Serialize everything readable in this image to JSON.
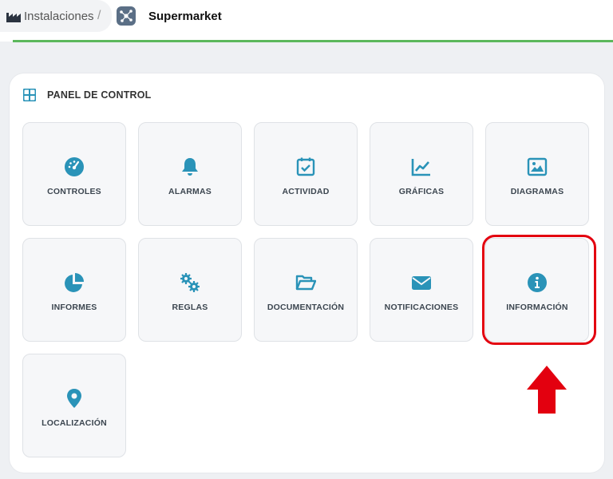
{
  "breadcrumb": {
    "home_label": "Instalaciones",
    "separator": "/",
    "site_name": "Supermarket"
  },
  "panel": {
    "title": "PANEL DE CONTROL"
  },
  "tiles": [
    {
      "label": "CONTROLES",
      "icon": "gauge-icon"
    },
    {
      "label": "ALARMAS",
      "icon": "bell-icon"
    },
    {
      "label": "ACTIVIDAD",
      "icon": "calendar-check-icon"
    },
    {
      "label": "GRÁFICAS",
      "icon": "line-chart-icon"
    },
    {
      "label": "DIAGRAMAS",
      "icon": "image-icon"
    },
    {
      "label": "INFORMES",
      "icon": "pie-chart-icon"
    },
    {
      "label": "REGLAS",
      "icon": "gears-icon"
    },
    {
      "label": "DOCUMENTACIÓN",
      "icon": "folder-open-icon"
    },
    {
      "label": "NOTIFICACIONES",
      "icon": "envelope-icon"
    },
    {
      "label": "INFORMACIÓN",
      "icon": "info-circle-icon"
    },
    {
      "label": "LOCALIZACIÓN",
      "icon": "map-marker-icon"
    }
  ],
  "colors": {
    "icon": "#2a93b8",
    "accent_line": "#5cb85c",
    "highlight": "#e3000f"
  }
}
